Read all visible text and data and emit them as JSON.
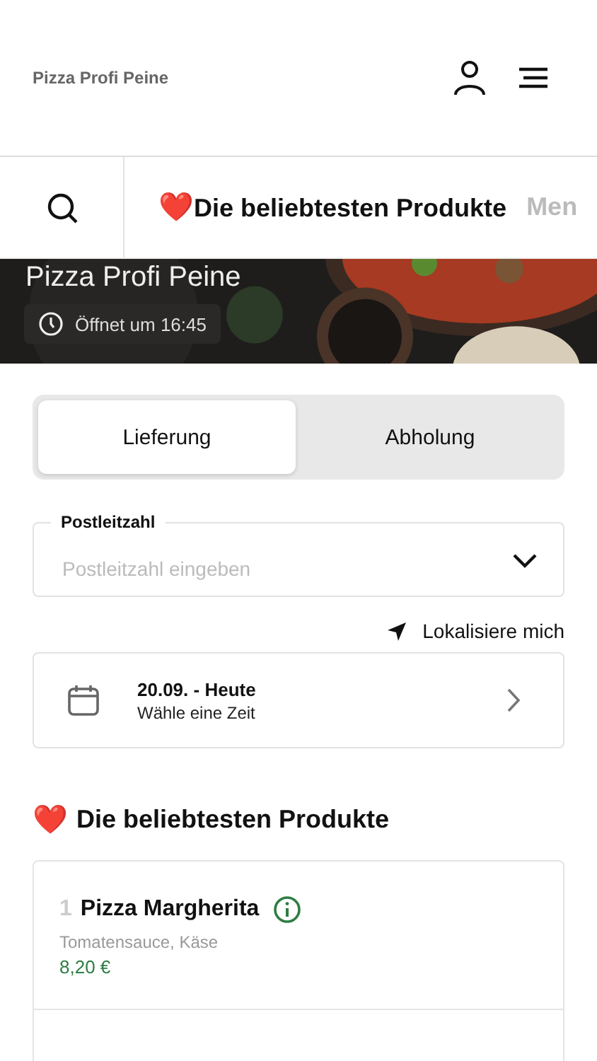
{
  "header": {
    "title": "Pizza Profi Peine"
  },
  "category_tabs": [
    {
      "emoji": "❤️",
      "label": "Die beliebtesten Produkte",
      "selected": true
    },
    {
      "label": "Men",
      "selected": false
    }
  ],
  "hero": {
    "title": "Pizza Profi Peine",
    "opening": "Öffnet um 16:45"
  },
  "mode_switch": [
    {
      "label": "Lieferung",
      "selected": true
    },
    {
      "label": "Abholung",
      "selected": false
    }
  ],
  "postcode": {
    "label": "Postleitzahl",
    "placeholder": "Postleitzahl eingeben"
  },
  "locate": "Lokalisiere mich",
  "time_picker": {
    "date": "20.09. - Heute",
    "hint": "Wähle eine Zeit"
  },
  "section": {
    "emoji": "❤️",
    "title": "Die beliebtesten Produkte"
  },
  "products": [
    {
      "rank": "1",
      "name": "Pizza Margherita",
      "description": "Tomatensauce, Käse",
      "price": "8,20 €"
    }
  ]
}
